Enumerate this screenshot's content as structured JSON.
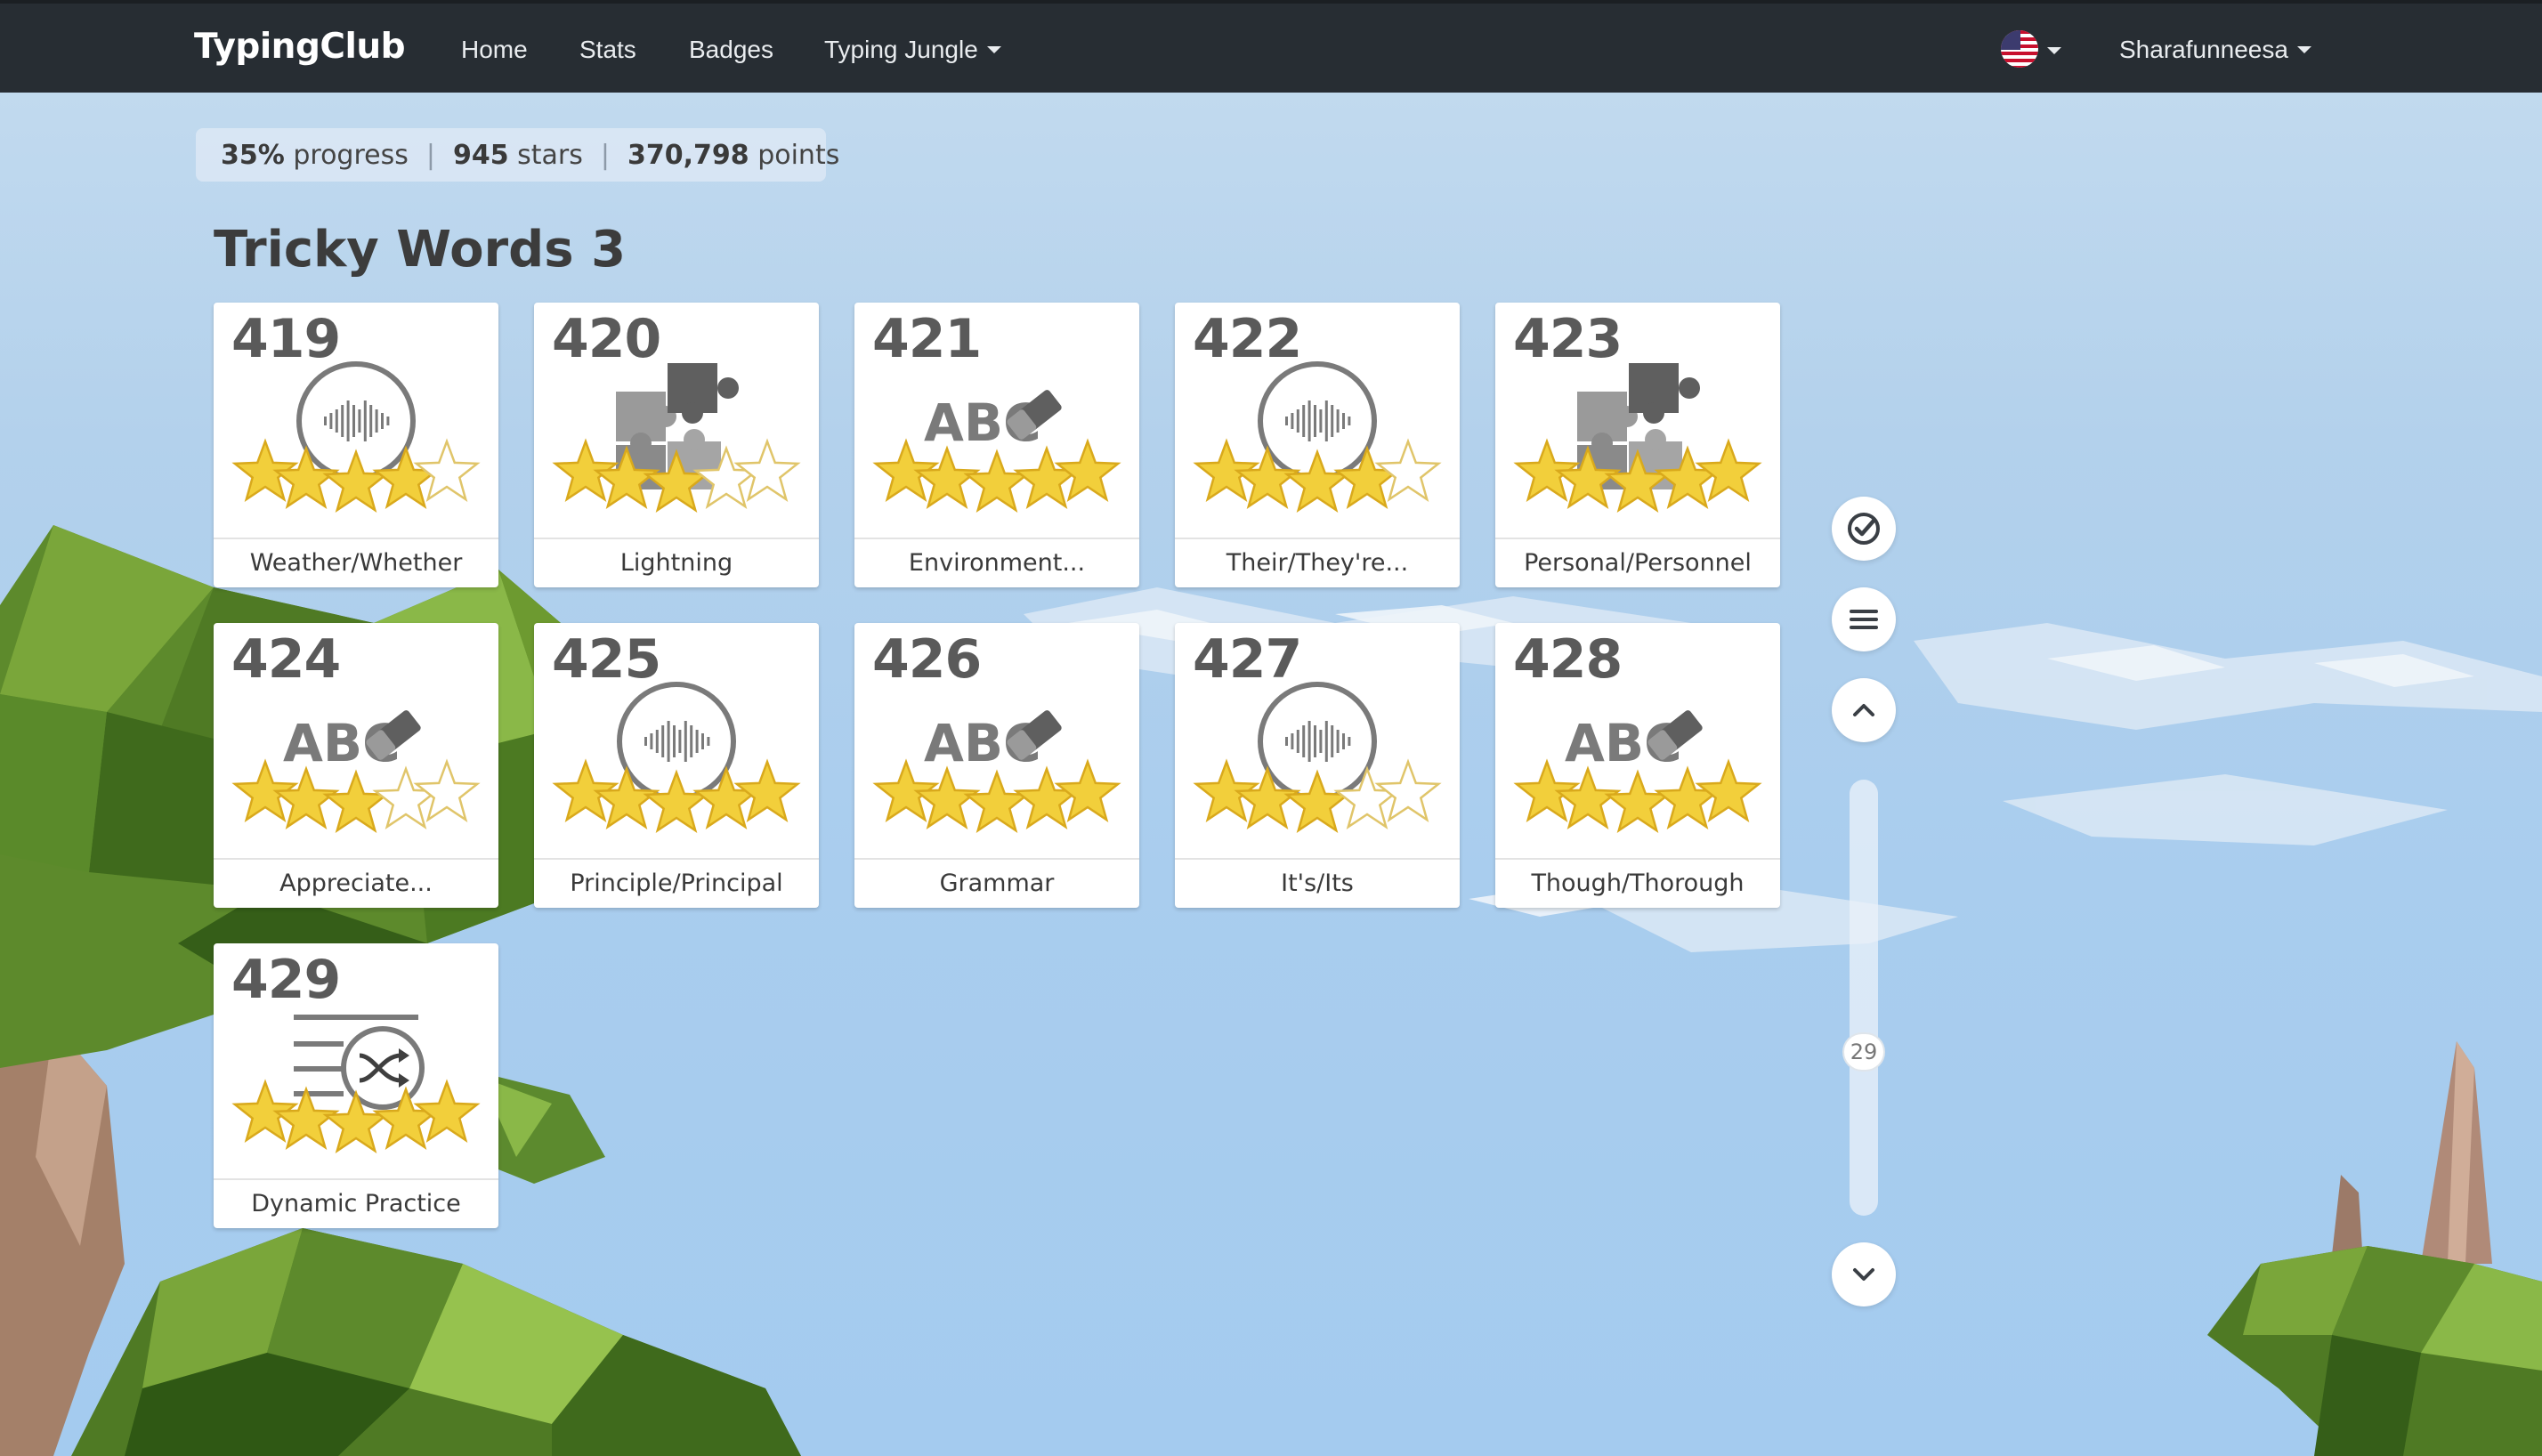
{
  "nav": {
    "brand": "TypingClub",
    "links": [
      "Home",
      "Stats",
      "Badges"
    ],
    "dropdown_label": "Typing Jungle",
    "user": "Sharafunneesa"
  },
  "progress": {
    "percent": "35%",
    "percent_label": "progress",
    "stars": "945",
    "stars_label": "stars",
    "points": "370,798",
    "points_label": "points"
  },
  "section_title": "Tricky Words 3",
  "lessons": [
    {
      "num": "419",
      "label": "Weather/Whether",
      "icon": "audio-icon",
      "stars": 4
    },
    {
      "num": "420",
      "label": "Lightning",
      "icon": "puzzle-icon",
      "stars": 3
    },
    {
      "num": "421",
      "label": "Environment...",
      "icon": "abc-eraser-icon",
      "stars": 5
    },
    {
      "num": "422",
      "label": "Their/They're...",
      "icon": "audio-icon",
      "stars": 4
    },
    {
      "num": "423",
      "label": "Personal/Personnel",
      "icon": "puzzle-icon",
      "stars": 5
    },
    {
      "num": "424",
      "label": "Appreciate...",
      "icon": "abc-eraser-icon",
      "stars": 3
    },
    {
      "num": "425",
      "label": "Principle/Principal",
      "icon": "audio-icon",
      "stars": 5
    },
    {
      "num": "426",
      "label": "Grammar",
      "icon": "abc-eraser-icon",
      "stars": 5
    },
    {
      "num": "427",
      "label": "It's/Its",
      "icon": "audio-icon",
      "stars": 3
    },
    {
      "num": "428",
      "label": "Though/Thorough",
      "icon": "abc-eraser-icon",
      "stars": 5
    },
    {
      "num": "429",
      "label": "Dynamic Practice",
      "icon": "shuffle-list-icon",
      "stars": 5
    }
  ],
  "abc_text": "ABC",
  "scroll_label": "29",
  "colors": {
    "navbar": "#272d33",
    "star_fill": "#f2cf3b",
    "icon_gray": "#7a7a7a"
  }
}
